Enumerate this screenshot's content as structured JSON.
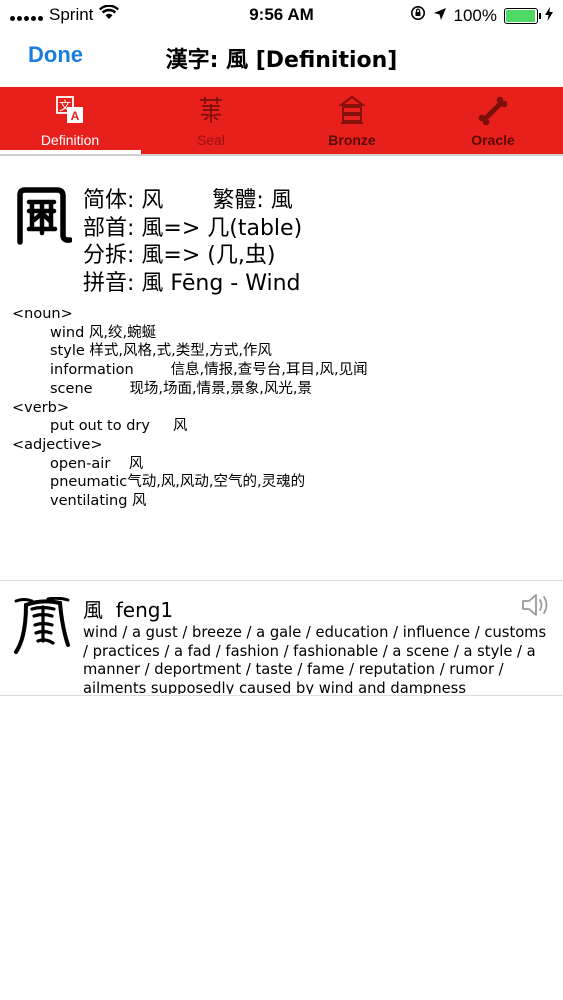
{
  "status_bar": {
    "carrier": "Sprint",
    "time": "9:56 AM",
    "battery_percent": "100%",
    "icons": [
      "wifi-icon",
      "lock-rotation-icon",
      "location-arrow-icon",
      "battery-icon",
      "charging-bolt-icon"
    ]
  },
  "nav": {
    "done_label": "Done",
    "title": "漢字: 風 [Definition]"
  },
  "tabs": [
    {
      "label": "Definition",
      "icon": "translate-icon",
      "active": true
    },
    {
      "label": "Seal",
      "icon": "seal-script-icon",
      "active": false
    },
    {
      "label": "Bronze",
      "icon": "bronze-script-icon",
      "active": false
    },
    {
      "label": "Oracle",
      "icon": "bone-icon",
      "active": false
    }
  ],
  "colors": {
    "tab_bar": "#e8201c",
    "link_blue": "#1a7de1",
    "battery_green": "#4cd964"
  },
  "definition": {
    "info_lines": [
      "简体: 风       繁體: 風",
      "部首: 風=> 几(table)",
      "分拆: 風=> (几,虫)",
      "拼音: 風 Fēng - Wind"
    ],
    "sections": [
      {
        "pos": "<noun>",
        "entries": [
          {
            "term": "wind",
            "gap": " ",
            "meaning": "风,绞,蜿蜒"
          },
          {
            "term": "style",
            "gap": " ",
            "meaning": "样式,风格,式,类型,方式,作风"
          },
          {
            "term": "information",
            "gap": "        ",
            "meaning": "信息,情报,查号台,耳目,风,见闻"
          },
          {
            "term": "scene",
            "gap": "        ",
            "meaning": "现场,场面,情景,景象,风光,景"
          }
        ]
      },
      {
        "pos": "<verb>",
        "entries": [
          {
            "term": "put out to dry",
            "gap": "     ",
            "meaning": "风"
          }
        ]
      },
      {
        "pos": "<adjective>",
        "entries": [
          {
            "term": "open-air",
            "gap": "    ",
            "meaning": "风"
          },
          {
            "term": "pneumatic",
            "gap": "",
            "meaning": "气动,风,风动,空气的,灵魂的"
          },
          {
            "term": "ventilating",
            "gap": " ",
            "meaning": "风"
          }
        ]
      }
    ]
  },
  "cedict": {
    "character": "風",
    "pinyin": "feng1",
    "speaker_icon": "speaker-icon",
    "definition": "wind / a gust / breeze / a gale / education / influence / customs / practices / a fad / fashion / fashionable / a scene / a style / a manner / deportment / taste / fame / reputation / rumor / ailments supposedly caused by wind and dampness"
  }
}
